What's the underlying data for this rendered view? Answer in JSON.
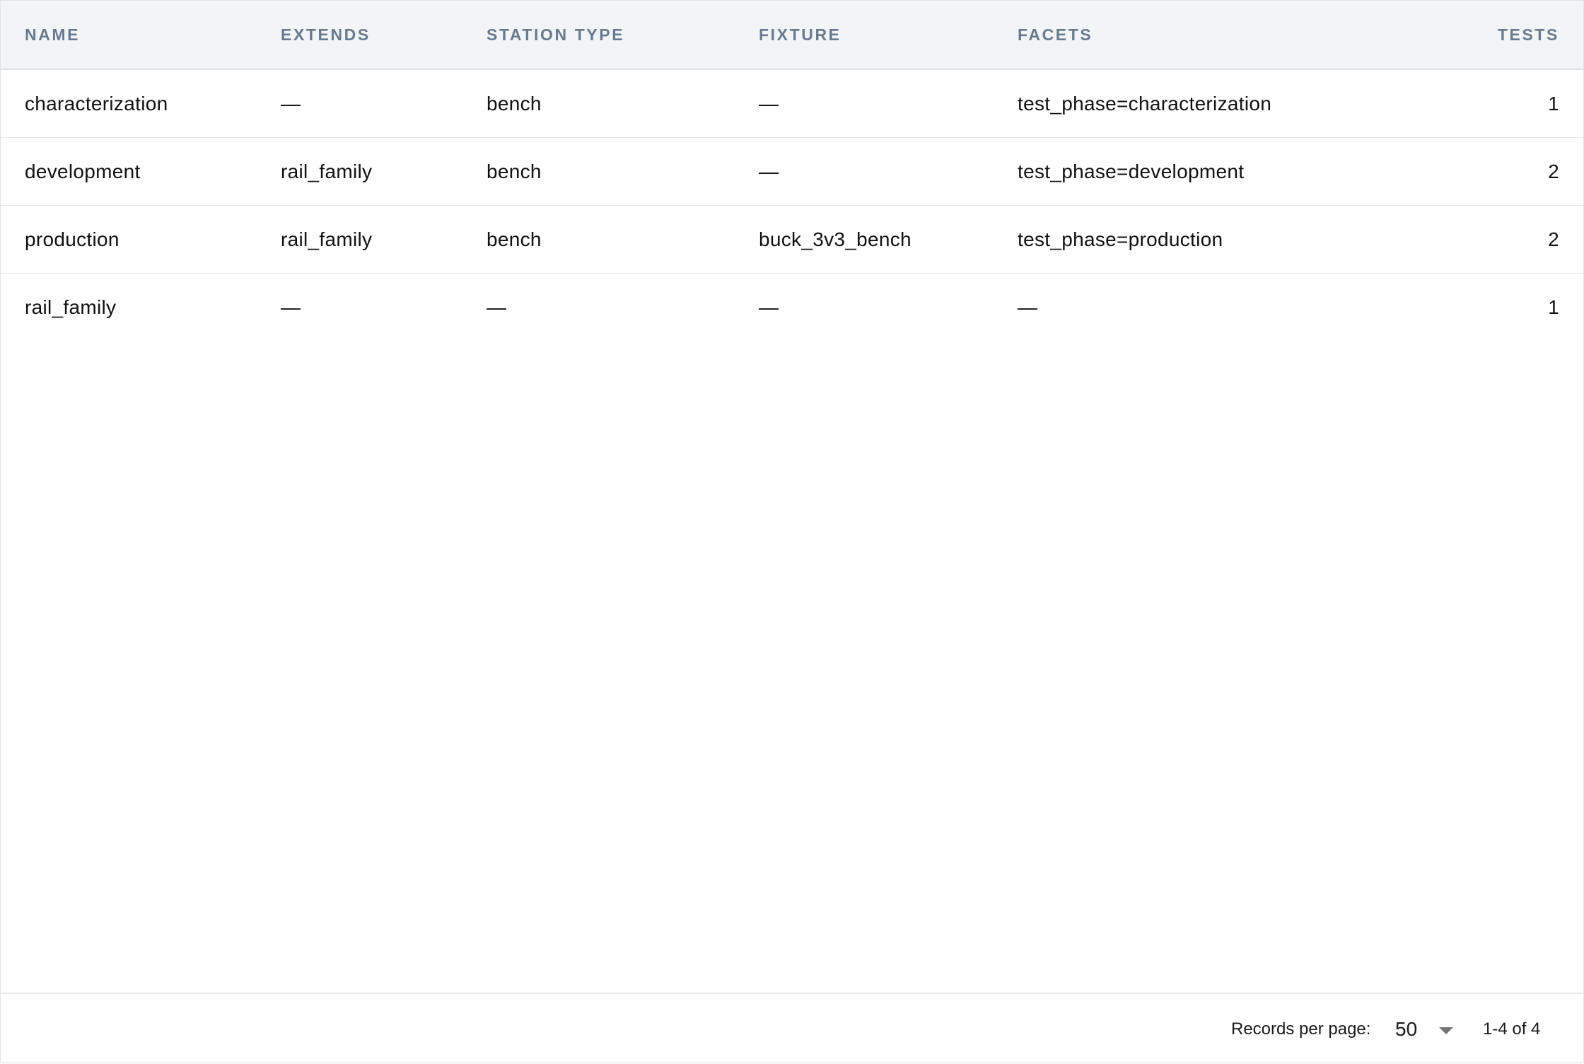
{
  "table": {
    "columns": {
      "name": "NAME",
      "extends": "EXTENDS",
      "station_type": "STATION TYPE",
      "fixture": "FIXTURE",
      "facets": "FACETS",
      "tests": "TESTS"
    },
    "rows": [
      {
        "name": "characterization",
        "extends": "—",
        "station_type": "bench",
        "fixture": "—",
        "facets": "test_phase=characterization",
        "tests": "1"
      },
      {
        "name": "development",
        "extends": "rail_family",
        "station_type": "bench",
        "fixture": "—",
        "facets": "test_phase=development",
        "tests": "2"
      },
      {
        "name": "production",
        "extends": "rail_family",
        "station_type": "bench",
        "fixture": "buck_3v3_bench",
        "facets": "test_phase=production",
        "tests": "2"
      },
      {
        "name": "rail_family",
        "extends": "—",
        "station_type": "—",
        "fixture": "—",
        "facets": "—",
        "tests": "1"
      }
    ]
  },
  "pagination": {
    "records_per_page_label": "Records per page:",
    "records_per_page_value": "50",
    "range_text": "1-4 of 4"
  },
  "colors": {
    "header_bg": "#f2f5f8",
    "header_text": "#6a7a8e",
    "border": "#e3e7eb"
  }
}
